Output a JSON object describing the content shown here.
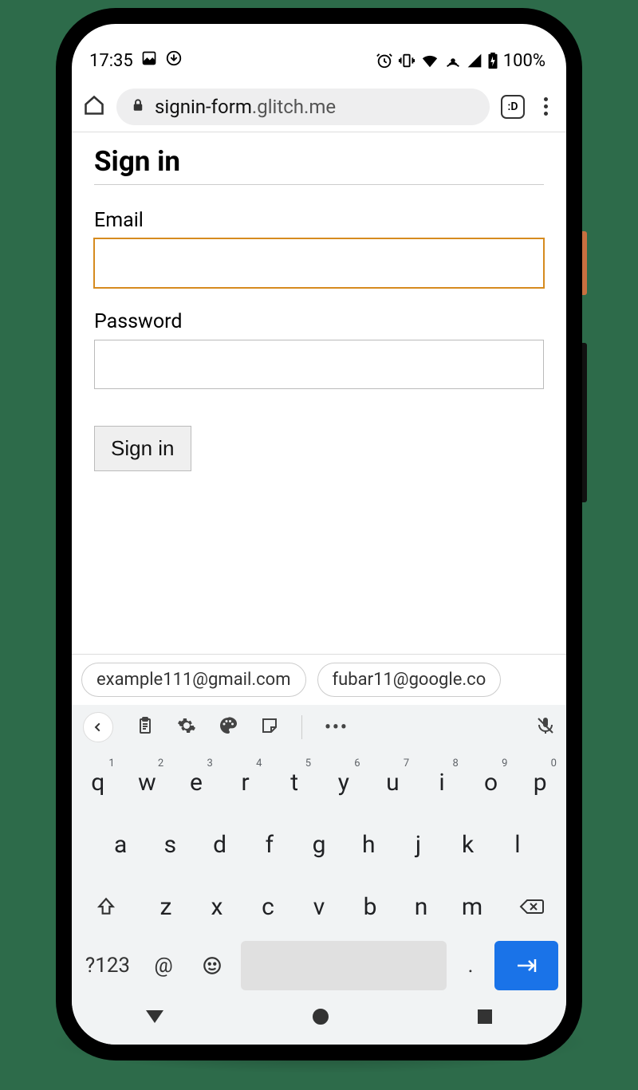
{
  "status": {
    "time": "17:35",
    "battery": "100%"
  },
  "browser": {
    "url_host": "signin-form",
    "url_path": ".glitch.me",
    "tabs_label": ":D"
  },
  "page": {
    "title": "Sign in",
    "email_label": "Email",
    "email_value": "",
    "password_label": "Password",
    "password_value": "",
    "submit_label": "Sign in"
  },
  "suggestions": [
    "example111@gmail.com",
    "fubar11@google.co"
  ],
  "keyboard": {
    "row1": [
      {
        "k": "q",
        "n": "1"
      },
      {
        "k": "w",
        "n": "2"
      },
      {
        "k": "e",
        "n": "3"
      },
      {
        "k": "r",
        "n": "4"
      },
      {
        "k": "t",
        "n": "5"
      },
      {
        "k": "y",
        "n": "6"
      },
      {
        "k": "u",
        "n": "7"
      },
      {
        "k": "i",
        "n": "8"
      },
      {
        "k": "o",
        "n": "9"
      },
      {
        "k": "p",
        "n": "0"
      }
    ],
    "row2": [
      "a",
      "s",
      "d",
      "f",
      "g",
      "h",
      "j",
      "k",
      "l"
    ],
    "row3": [
      "z",
      "x",
      "c",
      "v",
      "b",
      "n",
      "m"
    ],
    "sym_label": "?123",
    "at_label": "@",
    "dot_label": "."
  }
}
